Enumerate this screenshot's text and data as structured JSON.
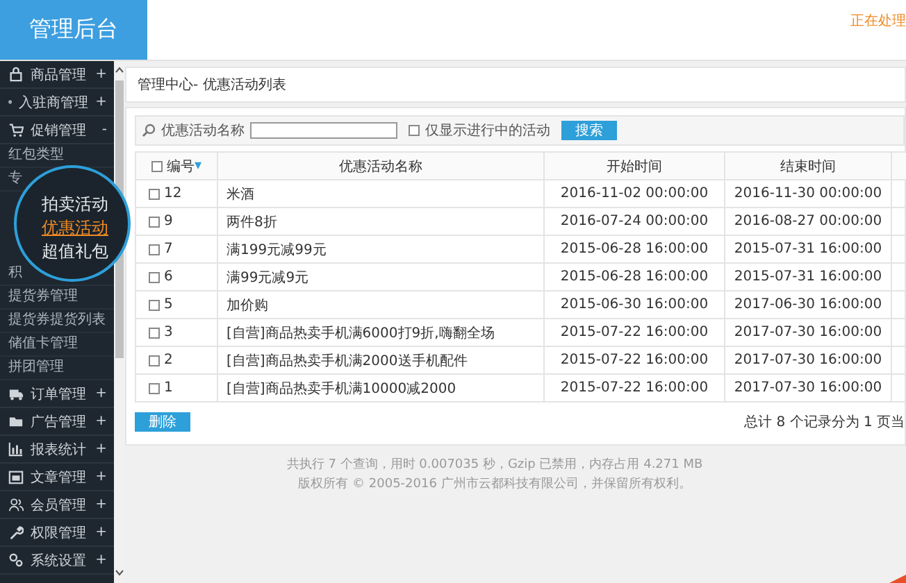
{
  "header": {
    "title": "管理后台",
    "notice": "正在处理"
  },
  "sidebar": {
    "items": [
      {
        "label": "商品管理",
        "toggle": "+"
      },
      {
        "label": "入驻商管理",
        "toggle": "+"
      },
      {
        "label": "促销管理",
        "toggle": "-",
        "children": [
          {
            "label": "红包类型",
            "kind": "item",
            "selected": false
          },
          {
            "label": "专",
            "kind": "item",
            "selected": false
          },
          {
            "label": "拍卖活动",
            "kind": "magnified",
            "selected": false
          },
          {
            "label": "优惠活动",
            "kind": "magnified",
            "selected": true
          },
          {
            "label": "超值礼包",
            "kind": "magnified",
            "selected": false
          },
          {
            "label": "积",
            "kind": "item",
            "selected": false
          },
          {
            "label": "提货券管理",
            "kind": "item",
            "selected": false
          },
          {
            "label": "提货券提货列表",
            "kind": "item",
            "selected": false
          },
          {
            "label": "储值卡管理",
            "kind": "item",
            "selected": false
          },
          {
            "label": "拼团管理",
            "kind": "item",
            "selected": false
          }
        ]
      },
      {
        "label": "订单管理",
        "toggle": "+"
      },
      {
        "label": "广告管理",
        "toggle": "+"
      },
      {
        "label": "报表统计",
        "toggle": "+"
      },
      {
        "label": "文章管理",
        "toggle": "+"
      },
      {
        "label": "会员管理",
        "toggle": "+"
      },
      {
        "label": "权限管理",
        "toggle": "+"
      },
      {
        "label": "系统设置",
        "toggle": "+"
      }
    ]
  },
  "breadcrumb": "管理中心- 优惠活动列表",
  "search": {
    "label": "优惠活动名称",
    "checkbox": {
      "label": "仅显示进行中的活动",
      "checked": false
    },
    "button": "搜索"
  },
  "table": {
    "select_all": {
      "checked": false
    },
    "columns": [
      {
        "label": "编号",
        "sort_mark": "▾"
      },
      {
        "label": "优惠活动名称"
      },
      {
        "label": "开始时间"
      },
      {
        "label": "结束时间"
      }
    ],
    "rows": [
      {
        "checked": false,
        "id": "12",
        "name": "米酒",
        "start": "2016-11-02 00:00:00",
        "end": "2016-11-30 00:00:00"
      },
      {
        "checked": false,
        "id": "9",
        "name": "两件8折",
        "start": "2016-07-24 00:00:00",
        "end": "2016-08-27 00:00:00"
      },
      {
        "checked": false,
        "id": "7",
        "name": "满199元减99元",
        "start": "2015-06-28 16:00:00",
        "end": "2015-07-31 16:00:00"
      },
      {
        "checked": false,
        "id": "6",
        "name": "满99元减9元",
        "start": "2015-06-28 16:00:00",
        "end": "2015-07-31 16:00:00"
      },
      {
        "checked": false,
        "id": "5",
        "name": "加价购",
        "start": "2015-06-30 16:00:00",
        "end": "2017-06-30 16:00:00"
      },
      {
        "checked": false,
        "id": "3",
        "name": "[自营]商品热卖手机满6000打9折,嗨翻全场",
        "start": "2015-07-22 16:00:00",
        "end": "2017-07-30 16:00:00"
      },
      {
        "checked": false,
        "id": "2",
        "name": "[自营]商品热卖手机满2000送手机配件",
        "start": "2015-07-22 16:00:00",
        "end": "2017-07-30 16:00:00"
      },
      {
        "checked": false,
        "id": "1",
        "name": "[自营]商品热卖手机满10000减2000",
        "start": "2015-07-22 16:00:00",
        "end": "2017-07-30 16:00:00"
      }
    ]
  },
  "delete_button": "删除",
  "pagination": "总计 8 个记录分为 1 页当",
  "footer": [
    "共执行 7 个查询，用时 0.007035 秒，Gzip 已禁用，内存占用 4.271 MB",
    "版权所有 © 2005-2016 广州市云都科技有限公司，并保留所有权利。"
  ]
}
